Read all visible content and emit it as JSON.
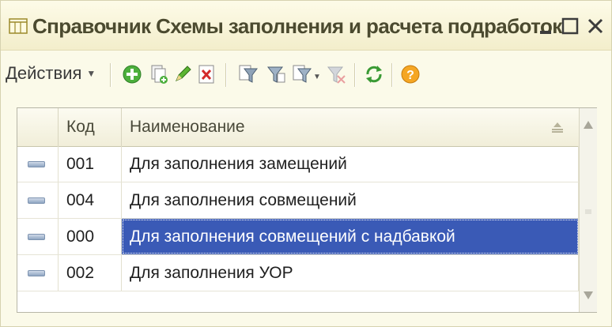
{
  "window": {
    "title": "Справочник Схемы заполнения и расчета подработок"
  },
  "icons": {
    "app": "table-list-icon",
    "minimize": "minimize-icon",
    "maximize": "maximize-icon",
    "close": "close-icon"
  },
  "toolbar": {
    "actions_label": "Действия",
    "buttons": [
      "add-icon",
      "copy-icon",
      "edit-icon",
      "delete-icon",
      "filter-icon",
      "filter-by-value-icon",
      "filter-list-icon",
      "clear-filter-icon",
      "refresh-icon",
      "help-icon"
    ]
  },
  "table": {
    "columns": [
      "Код",
      "Наименование"
    ],
    "rows": [
      {
        "code": "001",
        "name": "Для заполнения замещений",
        "selected": false
      },
      {
        "code": "004",
        "name": "Для заполнения совмещений",
        "selected": false
      },
      {
        "code": "000",
        "name": "Для заполнения совмещений с надбавкой",
        "selected": true
      },
      {
        "code": "002",
        "name": "Для заполнения УОР",
        "selected": false
      }
    ]
  },
  "colors": {
    "selection": "#3a5ab6",
    "window_bg": "#fbfae9",
    "add_green": "#4caf3c",
    "delete_red": "#d42a2a",
    "help_orange": "#f5a623"
  }
}
